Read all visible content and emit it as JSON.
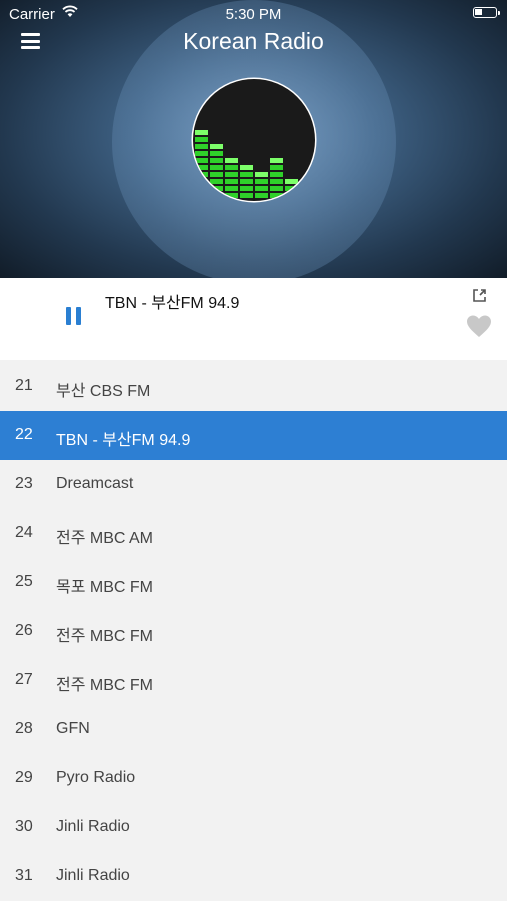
{
  "status_bar": {
    "carrier": "Carrier",
    "time": "5:30 PM"
  },
  "header": {
    "title": "Korean Radio",
    "menu_icon": "hamburger-menu-icon"
  },
  "player": {
    "now_playing": "TBN - 부산FM 94.9",
    "state": "playing",
    "accent_color": "#2d7fd3",
    "icons": [
      "pause-icon",
      "share-icon",
      "heart-icon"
    ]
  },
  "stations": [
    {
      "num": "21",
      "name": "부산 CBS FM"
    },
    {
      "num": "22",
      "name": "TBN - 부산FM 94.9",
      "active": true
    },
    {
      "num": "23",
      "name": "Dreamcast"
    },
    {
      "num": "24",
      "name": "전주 MBC AM"
    },
    {
      "num": "25",
      "name": "목포 MBC FM"
    },
    {
      "num": "26",
      "name": "전주 MBC FM"
    },
    {
      "num": "27",
      "name": "전주 MBC FM"
    },
    {
      "num": "28",
      "name": "GFN"
    },
    {
      "num": "29",
      "name": "Pyro Radio"
    },
    {
      "num": "30",
      "name": "Jinli Radio"
    },
    {
      "num": "31",
      "name": "Jinli Radio"
    }
  ]
}
